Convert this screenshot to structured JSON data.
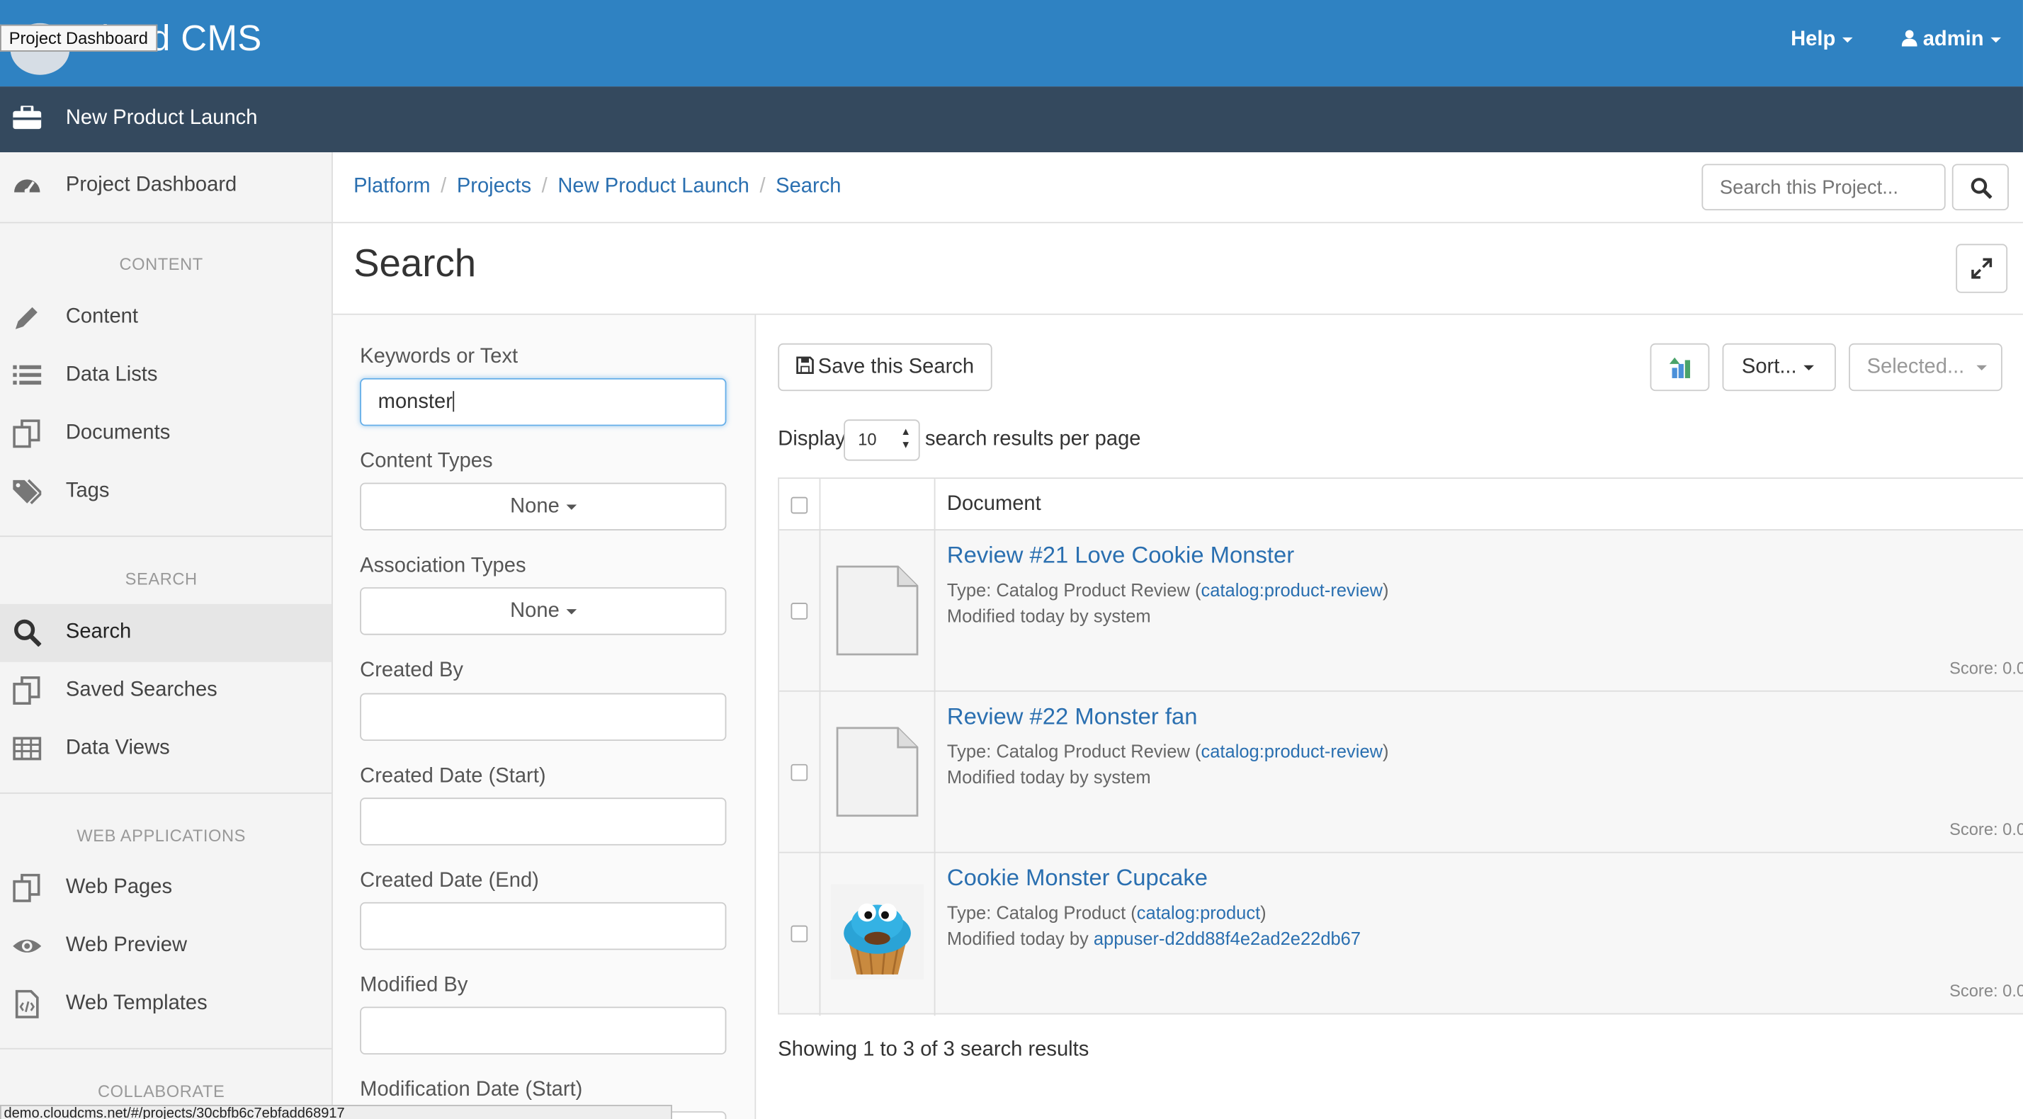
{
  "app": {
    "brand": "Cloud CMS",
    "tooltip": "Project Dashboard"
  },
  "topnav": {
    "help": "Help",
    "user": "admin"
  },
  "project_bar": {
    "title": "New Product Launch"
  },
  "sidebar": {
    "dashboard": "Project Dashboard",
    "sections": [
      {
        "heading": "CONTENT",
        "items": [
          "Content",
          "Data Lists",
          "Documents",
          "Tags"
        ]
      },
      {
        "heading": "SEARCH",
        "items": [
          "Search",
          "Saved Searches",
          "Data Views"
        ]
      },
      {
        "heading": "WEB APPLICATIONS",
        "items": [
          "Web Pages",
          "Web Preview",
          "Web Templates"
        ]
      },
      {
        "heading": "COLLABORATE",
        "items": []
      }
    ]
  },
  "breadcrumb": [
    "Platform",
    "Projects",
    "New Product Launch",
    "Search"
  ],
  "project_search": {
    "placeholder": "Search this Project..."
  },
  "page": {
    "title": "Search"
  },
  "filters": {
    "keywords_label": "Keywords or Text",
    "keywords_value": "monster",
    "content_types_label": "Content Types",
    "content_types_value": "None",
    "association_types_label": "Association Types",
    "association_types_value": "None",
    "created_by_label": "Created By",
    "created_start_label": "Created Date (Start)",
    "created_end_label": "Created Date (End)",
    "modified_by_label": "Modified By",
    "modification_start_label": "Modification Date (Start)"
  },
  "results": {
    "save_label": "Save this Search",
    "sort_label": "Sort...",
    "selected_label": "Selected...",
    "display_prefix": "Display",
    "per_page": "10",
    "display_suffix": "search results per page",
    "column_document": "Document",
    "rows": [
      {
        "title": "Review #21 Love Cookie Monster",
        "type_prefix": "Type: Catalog Product Review (",
        "type_qname": "catalog:product-review",
        "type_suffix": ")",
        "modified_prefix": "Modified today by ",
        "modified_by": "system",
        "score": "Score: 0.0"
      },
      {
        "title": "Review #22 Monster fan",
        "type_prefix": "Type: Catalog Product Review (",
        "type_qname": "catalog:product-review",
        "type_suffix": ")",
        "modified_prefix": "Modified today by ",
        "modified_by": "system",
        "score": "Score: 0.0"
      },
      {
        "title": "Cookie Monster Cupcake",
        "type_prefix": "Type: Catalog Product (",
        "type_qname": "catalog:product",
        "type_suffix": ")",
        "modified_prefix": "Modified today by ",
        "modified_by": "appuser-d2dd88f4e2ad2e22db67",
        "score": "Score: 0.0"
      }
    ],
    "showing": "Showing 1 to 3 of 3 search results"
  },
  "statusbar": {
    "url": "demo.cloudcms.net/#/projects/30cbfb6c7ebfadd68917"
  },
  "colors": {
    "topbar": "#2f82c2",
    "projbar": "#34495e",
    "link": "#2a6fb0"
  }
}
